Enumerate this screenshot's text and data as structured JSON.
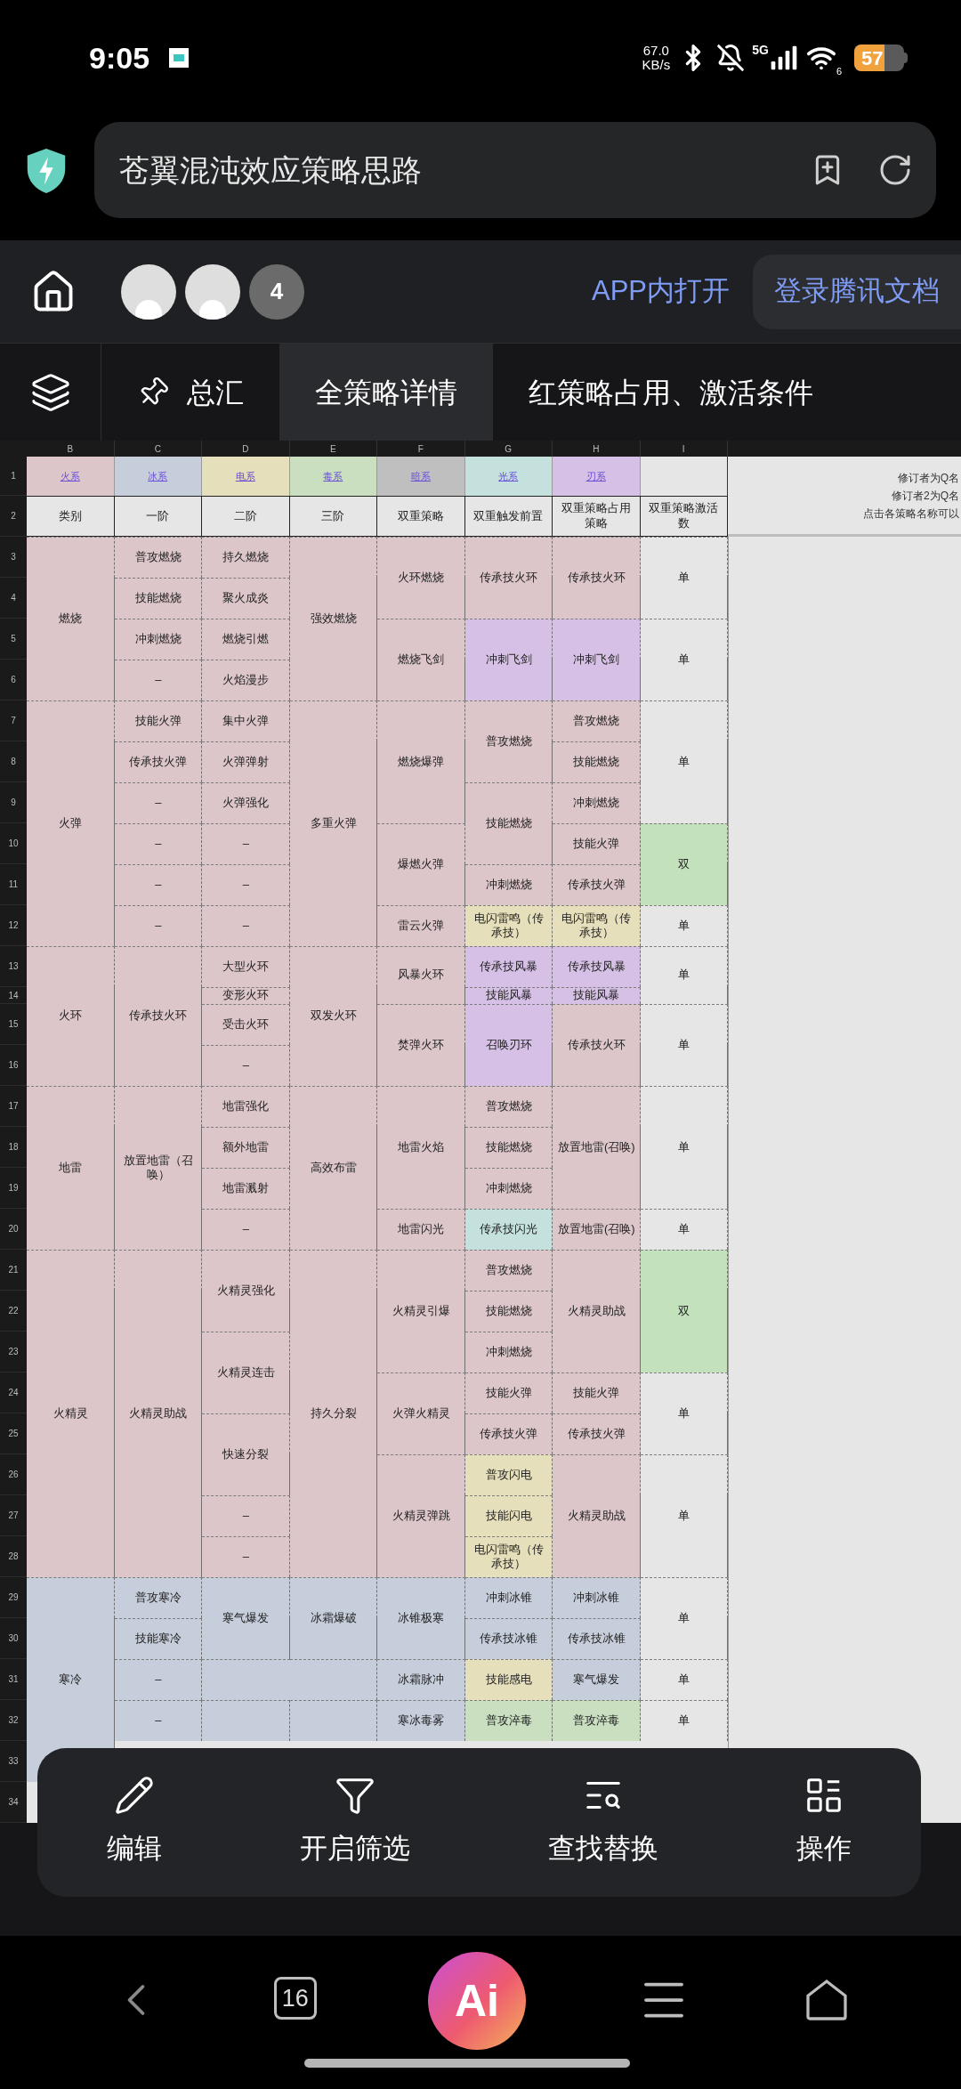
{
  "status_bar": {
    "time": "9:05",
    "net_speed": [
      "67.0",
      "KB/s"
    ],
    "network": "5G",
    "wifi_badge": "6",
    "battery": "57"
  },
  "address_bar": {
    "title": "苍翼混沌效应策略思路"
  },
  "app_header": {
    "collaborator_count": "4",
    "open_in_app": "APP内打开",
    "login": "登录腾讯文档"
  },
  "sheet_tabs": [
    {
      "label": "总汇",
      "selected": false,
      "pinned": true
    },
    {
      "label": "全策略详情",
      "selected": true,
      "pinned": false
    },
    {
      "label": "红策略占用、激活条件",
      "selected": false,
      "pinned": false
    }
  ],
  "sheet": {
    "column_letters": [
      "B",
      "C",
      "D",
      "E",
      "F",
      "G",
      "H",
      "I"
    ],
    "row_numbers": [
      "1",
      "2",
      "3",
      "4",
      "5",
      "6",
      "7",
      "8",
      "9",
      "10",
      "11",
      "12",
      "13",
      "14",
      "15",
      "16",
      "17",
      "18",
      "19",
      "20",
      "21",
      "22",
      "23",
      "24",
      "25",
      "26",
      "27",
      "28",
      "29",
      "30",
      "31",
      "32",
      "33",
      "34"
    ],
    "element_row": [
      {
        "label": "火系",
        "color": "#dcc6c9"
      },
      {
        "label": "冰系",
        "color": "#c6cedb"
      },
      {
        "label": "电系",
        "color": "#e6dfbb"
      },
      {
        "label": "毒系",
        "color": "#c9dfc0"
      },
      {
        "label": "暗系",
        "color": "#bfbfbf"
      },
      {
        "label": "光系",
        "color": "#c4e1dd"
      },
      {
        "label": "刃系",
        "color": "#d7c0e6"
      }
    ],
    "header_row": [
      "类别",
      "一阶",
      "二阶",
      "三阶",
      "双重策略",
      "双重触发前置",
      "双重策略占用策略",
      "双重策略激活数"
    ],
    "notes": [
      "修订者为Q名",
      "修订者2为Q名",
      "点击各策略名称可以"
    ],
    "columns": [
      [
        {
          "text": "燃烧",
          "color": "#dcc6c9",
          "merged_up": false
        },
        {
          "merged_up": true
        },
        {
          "merged_up": true
        },
        {
          "merged_up": true
        },
        {
          "text": "火弹",
          "color": "#dcc6c9",
          "merged_up": false
        },
        {
          "merged_up": true
        },
        {
          "merged_up": true
        },
        {
          "merged_up": true
        },
        {
          "merged_up": true
        },
        {
          "merged_up": true
        },
        {
          "text": "火环",
          "color": "#dcc6c9",
          "merged_up": false
        },
        {
          "merged_up": true
        },
        {
          "merged_up": true
        },
        {
          "merged_up": true
        },
        {
          "text": "地雷",
          "color": "#dcc6c9",
          "merged_up": false
        },
        {
          "merged_up": true
        },
        {
          "merged_up": true
        },
        {
          "merged_up": true
        },
        {
          "text": "火精灵",
          "color": "#dcc6c9",
          "merged_up": false
        },
        {
          "merged_up": true
        },
        {
          "merged_up": true
        },
        {
          "merged_up": true
        },
        {
          "merged_up": true
        },
        {
          "merged_up": true
        },
        {
          "merged_up": true
        },
        {
          "merged_up": true
        },
        {
          "text": "寒冷",
          "color": "#c6cedb",
          "merged_up": false
        },
        {
          "merged_up": true
        },
        {
          "merged_up": true
        },
        {
          "merged_up": true
        },
        {
          "merged_up": true
        }
      ],
      [
        {
          "text": "普攻燃烧",
          "color": "#dcc6c9",
          "merged_up": false
        },
        {
          "text": "技能燃烧",
          "color": "#dcc6c9",
          "merged_up": false
        },
        {
          "text": "冲刺燃烧",
          "color": "#dcc6c9",
          "merged_up": false
        },
        {
          "text": "–",
          "color": "#dcc6c9",
          "merged_up": false
        },
        {
          "text": "技能火弹",
          "color": "#dcc6c9",
          "merged_up": false
        },
        {
          "text": "传承技火弹",
          "color": "#dcc6c9",
          "merged_up": false
        },
        {
          "text": "–",
          "color": "#dcc6c9",
          "merged_up": false
        },
        {
          "text": "–",
          "color": "#dcc6c9",
          "merged_up": false
        },
        {
          "text": "–",
          "color": "#dcc6c9",
          "merged_up": false
        },
        {
          "text": "–",
          "color": "#dcc6c9",
          "merged_up": false
        },
        {
          "text": "传承技火环",
          "color": "#dcc6c9",
          "merged_up": false
        },
        {
          "merged_up": true
        },
        {
          "merged_up": true
        },
        {
          "merged_up": true
        },
        {
          "text": "放置地雷（召唤）",
          "color": "#dcc6c9",
          "merged_up": false
        },
        {
          "merged_up": true
        },
        {
          "merged_up": true
        },
        {
          "merged_up": true
        },
        {
          "text": "火精灵助战",
          "color": "#dcc6c9",
          "merged_up": false
        },
        {
          "merged_up": true
        },
        {
          "merged_up": true
        },
        {
          "merged_up": true
        },
        {
          "merged_up": true
        },
        {
          "merged_up": true
        },
        {
          "merged_up": true
        },
        {
          "merged_up": true
        },
        {
          "text": "普攻寒冷",
          "color": "#c6cedb",
          "merged_up": false
        },
        {
          "text": "技能寒冷",
          "color": "#c6cedb",
          "merged_up": false
        },
        {
          "text": "–",
          "color": "#c6cedb",
          "merged_up": false
        },
        {
          "text": "–",
          "color": "#c6cedb",
          "merged_up": false
        }
      ],
      [
        {
          "text": "持久燃烧",
          "color": "#dcc6c9",
          "merged_up": false
        },
        {
          "text": "聚火成炎",
          "color": "#dcc6c9",
          "merged_up": false
        },
        {
          "text": "燃烧引燃",
          "color": "#dcc6c9",
          "merged_up": false
        },
        {
          "text": "火焰漫步",
          "color": "#dcc6c9",
          "merged_up": false
        },
        {
          "text": "集中火弹",
          "color": "#dcc6c9",
          "merged_up": false
        },
        {
          "text": "火弹弹射",
          "color": "#dcc6c9",
          "merged_up": false
        },
        {
          "text": "火弹强化",
          "color": "#dcc6c9",
          "merged_up": false
        },
        {
          "text": "–",
          "color": "#dcc6c9",
          "merged_up": false
        },
        {
          "text": "–",
          "color": "#dcc6c9",
          "merged_up": false
        },
        {
          "text": "–",
          "color": "#dcc6c9",
          "merged_up": false
        },
        {
          "text": "大型火环",
          "color": "#dcc6c9",
          "merged_up": false
        },
        {
          "text": "变形火环",
          "color": "#dcc6c9",
          "merged_up": false
        },
        {
          "text": "受击火环",
          "color": "#dcc6c9",
          "merged_up": false
        },
        {
          "text": "–",
          "color": "#dcc6c9",
          "merged_up": false
        },
        {
          "text": "地雷强化",
          "color": "#dcc6c9",
          "merged_up": false
        },
        {
          "text": "额外地雷",
          "color": "#dcc6c9",
          "merged_up": false
        },
        {
          "text": "地雷溅射",
          "color": "#dcc6c9",
          "merged_up": false
        },
        {
          "text": "–",
          "color": "#dcc6c9",
          "merged_up": false
        },
        {
          "text": "火精灵强化",
          "color": "#dcc6c9",
          "merged_up": false
        },
        {
          "merged_up": true
        },
        {
          "text": "火精灵连击",
          "color": "#dcc6c9",
          "merged_up": false
        },
        {
          "merged_up": true
        },
        {
          "text": "快速分裂",
          "color": "#dcc6c9",
          "merged_up": false
        },
        {
          "merged_up": true
        },
        {
          "text": "–",
          "color": "#dcc6c9",
          "merged_up": false
        },
        {
          "text": "–",
          "color": "#dcc6c9",
          "merged_up": false
        },
        {
          "text": "寒气爆发",
          "color": "#c6cedb",
          "merged_up": false
        },
        {
          "merged_up": true
        },
        {
          "color": "#c6cedb",
          "merged_up": false,
          "merged_right": true
        },
        {
          "color": "#c6cedb",
          "merged_up": false
        }
      ],
      [
        {
          "text": "强效燃烧",
          "color": "#dcc6c9",
          "merged_up": false
        },
        {
          "merged_up": true
        },
        {
          "merged_up": true
        },
        {
          "merged_up": true
        },
        {
          "text": "多重火弹",
          "color": "#dcc6c9",
          "merged_up": false
        },
        {
          "merged_up": true
        },
        {
          "merged_up": true
        },
        {
          "merged_up": true
        },
        {
          "merged_up": true
        },
        {
          "merged_up": true
        },
        {
          "text": "双发火环",
          "color": "#dcc6c9",
          "merged_up": false
        },
        {
          "merged_up": true
        },
        {
          "merged_up": true
        },
        {
          "merged_up": true
        },
        {
          "text": "高效布雷",
          "color": "#dcc6c9",
          "merged_up": false
        },
        {
          "merged_up": true
        },
        {
          "merged_up": true
        },
        {
          "merged_up": true
        },
        {
          "text": "持久分裂",
          "color": "#dcc6c9",
          "merged_up": false
        },
        {
          "merged_up": true
        },
        {
          "merged_up": true
        },
        {
          "merged_up": true
        },
        {
          "merged_up": true
        },
        {
          "merged_up": true
        },
        {
          "merged_up": true
        },
        {
          "merged_up": true
        },
        {
          "text": "冰霜爆破",
          "color": "#c6cedb",
          "merged_up": false
        },
        {
          "merged_up": true
        },
        {
          "color": "#c6cedb",
          "merged_up": false
        },
        {
          "color": "#c6cedb",
          "merged_up": false
        }
      ],
      [
        {
          "text": "火环燃烧",
          "color": "#dcc6c9",
          "merged_up": false
        },
        {
          "merged_up": true
        },
        {
          "text": "燃烧飞剑",
          "color": "#dcc6c9",
          "merged_up": false
        },
        {
          "merged_up": true
        },
        {
          "text": "燃烧爆弹",
          "color": "#dcc6c9",
          "merged_up": false
        },
        {
          "merged_up": true
        },
        {
          "merged_up": true
        },
        {
          "text": "爆燃火弹",
          "color": "#dcc6c9",
          "merged_up": false
        },
        {
          "merged_up": true
        },
        {
          "text": "雷云火弹",
          "color": "#dcc6c9",
          "merged_up": false
        },
        {
          "text": "风暴火环",
          "color": "#dcc6c9",
          "merged_up": false
        },
        {
          "merged_up": true
        },
        {
          "text": "焚弹火环",
          "color": "#dcc6c9",
          "merged_up": false
        },
        {
          "merged_up": true
        },
        {
          "text": "地雷火焰",
          "color": "#dcc6c9",
          "merged_up": false
        },
        {
          "merged_up": true
        },
        {
          "merged_up": true
        },
        {
          "text": "地雷闪光",
          "color": "#dcc6c9",
          "merged_up": false
        },
        {
          "text": "火精灵引爆",
          "color": "#dcc6c9",
          "merged_up": false
        },
        {
          "merged_up": true
        },
        {
          "merged_up": true
        },
        {
          "text": "火弹火精灵",
          "color": "#dcc6c9",
          "merged_up": false
        },
        {
          "merged_up": true
        },
        {
          "text": "火精灵弹跳",
          "color": "#dcc6c9",
          "merged_up": false
        },
        {
          "merged_up": true
        },
        {
          "merged_up": true
        },
        {
          "text": "冰锥极寒",
          "color": "#c6cedb",
          "merged_up": false
        },
        {
          "merged_up": true
        },
        {
          "text": "冰霜脉冲",
          "color": "#c6cedb",
          "merged_up": false
        },
        {
          "text": "寒冰毒雾",
          "color": "#c6cedb",
          "merged_up": false
        }
      ],
      [
        {
          "text": "传承技火环",
          "color": "#dcc6c9",
          "merged_up": false
        },
        {
          "merged_up": true
        },
        {
          "text": "冲刺飞剑",
          "color": "#d7c0e6",
          "merged_up": false
        },
        {
          "merged_up": true
        },
        {
          "text": "普攻燃烧",
          "color": "#dcc6c9",
          "merged_up": false
        },
        {
          "merged_up": true
        },
        {
          "text": "技能燃烧",
          "color": "#dcc6c9",
          "merged_up": false
        },
        {
          "merged_up": true
        },
        {
          "text": "冲刺燃烧",
          "color": "#dcc6c9",
          "merged_up": false
        },
        {
          "text": "电闪雷鸣（传承技）",
          "color": "#e6dfbb",
          "merged_up": false
        },
        {
          "text": "传承技风暴",
          "color": "#d7c0e6",
          "merged_up": false
        },
        {
          "text": "技能风暴",
          "color": "#d7c0e6",
          "merged_up": false
        },
        {
          "text": "召唤刃环",
          "color": "#d7c0e6",
          "merged_up": false
        },
        {
          "merged_up": true
        },
        {
          "text": "普攻燃烧",
          "color": "#dcc6c9",
          "merged_up": false
        },
        {
          "text": "技能燃烧",
          "color": "#dcc6c9",
          "merged_up": false
        },
        {
          "text": "冲刺燃烧",
          "color": "#dcc6c9",
          "merged_up": false
        },
        {
          "text": "传承技闪光",
          "color": "#c4e1dd",
          "merged_up": false
        },
        {
          "text": "普攻燃烧",
          "color": "#dcc6c9",
          "merged_up": false
        },
        {
          "text": "技能燃烧",
          "color": "#dcc6c9",
          "merged_up": false
        },
        {
          "text": "冲刺燃烧",
          "color": "#dcc6c9",
          "merged_up": false
        },
        {
          "text": "技能火弹",
          "color": "#dcc6c9",
          "merged_up": false
        },
        {
          "text": "传承技火弹",
          "color": "#dcc6c9",
          "merged_up": false
        },
        {
          "text": "普攻闪电",
          "color": "#e6dfbb",
          "merged_up": false
        },
        {
          "text": "技能闪电",
          "color": "#e6dfbb",
          "merged_up": false
        },
        {
          "text": "电闪雷鸣（传承技）",
          "color": "#e6dfbb",
          "merged_up": false
        },
        {
          "text": "冲刺冰锥",
          "color": "#c6cedb",
          "merged_up": false
        },
        {
          "text": "传承技冰锥",
          "color": "#c6cedb",
          "merged_up": false
        },
        {
          "text": "技能感电",
          "color": "#e6dfbb",
          "merged_up": false
        },
        {
          "text": "普攻淬毒",
          "color": "#c9dfc0",
          "merged_up": false
        }
      ],
      [
        {
          "text": "传承技火环",
          "color": "#dcc6c9",
          "merged_up": false
        },
        {
          "merged_up": true
        },
        {
          "text": "冲刺飞剑",
          "color": "#d7c0e6",
          "merged_up": false
        },
        {
          "merged_up": true
        },
        {
          "text": "普攻燃烧",
          "color": "#dcc6c9",
          "merged_up": false
        },
        {
          "text": "技能燃烧",
          "color": "#dcc6c9",
          "merged_up": false
        },
        {
          "text": "冲刺燃烧",
          "color": "#dcc6c9",
          "merged_up": false
        },
        {
          "text": "技能火弹",
          "color": "#dcc6c9",
          "merged_up": false
        },
        {
          "text": "传承技火弹",
          "color": "#dcc6c9",
          "merged_up": false
        },
        {
          "text": "电闪雷鸣（传承技）",
          "color": "#e6dfbb",
          "merged_up": false
        },
        {
          "text": "传承技风暴",
          "color": "#d7c0e6",
          "merged_up": false
        },
        {
          "text": "技能风暴",
          "color": "#d7c0e6",
          "merged_up": false
        },
        {
          "text": "传承技火环",
          "color": "#dcc6c9",
          "merged_up": false
        },
        {
          "merged_up": true
        },
        {
          "text": "放置地雷(召唤)",
          "color": "#dcc6c9",
          "merged_up": false
        },
        {
          "merged_up": true
        },
        {
          "merged_up": true
        },
        {
          "text": "放置地雷(召唤)",
          "color": "#dcc6c9",
          "merged_up": false
        },
        {
          "text": "火精灵助战",
          "color": "#dcc6c9",
          "merged_up": false
        },
        {
          "merged_up": true
        },
        {
          "merged_up": true
        },
        {
          "text": "技能火弹",
          "color": "#dcc6c9",
          "merged_up": false
        },
        {
          "text": "传承技火弹",
          "color": "#dcc6c9",
          "merged_up": false
        },
        {
          "text": "火精灵助战",
          "color": "#dcc6c9",
          "merged_up": false
        },
        {
          "merged_up": true
        },
        {
          "merged_up": true
        },
        {
          "text": "冲刺冰锥",
          "color": "#c6cedb",
          "merged_up": false
        },
        {
          "text": "传承技冰锥",
          "color": "#c6cedb",
          "merged_up": false
        },
        {
          "text": "寒气爆发",
          "color": "#c6cedb",
          "merged_up": false
        },
        {
          "text": "普攻淬毒",
          "color": "#c9dfc0",
          "merged_up": false
        }
      ],
      [
        {
          "text": "单",
          "color": "#e6e6e6",
          "merged_up": false
        },
        {
          "merged_up": true
        },
        {
          "text": "单",
          "color": "#e6e6e6",
          "merged_up": false
        },
        {
          "merged_up": true
        },
        {
          "text": "单",
          "color": "#e6e6e6",
          "merged_up": false
        },
        {
          "merged_up": true
        },
        {
          "merged_up": true
        },
        {
          "text": "双",
          "color": "#c3e2bc",
          "merged_up": false
        },
        {
          "merged_up": true
        },
        {
          "text": "单",
          "color": "#e6e6e6",
          "merged_up": false
        },
        {
          "text": "单",
          "color": "#e6e6e6",
          "merged_up": false
        },
        {
          "merged_up": true
        },
        {
          "text": "单",
          "color": "#e6e6e6",
          "merged_up": false
        },
        {
          "merged_up": true
        },
        {
          "text": "单",
          "color": "#e6e6e6",
          "merged_up": false
        },
        {
          "merged_up": true
        },
        {
          "merged_up": true
        },
        {
          "text": "单",
          "color": "#e6e6e6",
          "merged_up": false
        },
        {
          "text": "双",
          "color": "#c3e2bc",
          "merged_up": false
        },
        {
          "merged_up": true
        },
        {
          "merged_up": true
        },
        {
          "text": "单",
          "color": "#e6e6e6",
          "merged_up": false
        },
        {
          "merged_up": true
        },
        {
          "text": "单",
          "color": "#e6e6e6",
          "merged_up": false
        },
        {
          "merged_up": true
        },
        {
          "merged_up": true
        },
        {
          "text": "单",
          "color": "#e6e6e6",
          "merged_up": false
        },
        {
          "merged_up": true
        },
        {
          "text": "单",
          "color": "#e6e6e6",
          "merged_up": false
        },
        {
          "text": "单",
          "color": "#e6e6e6",
          "merged_up": false
        }
      ]
    ]
  },
  "toolbar": [
    {
      "label": "编辑",
      "kind": "edit"
    },
    {
      "label": "开启筛选",
      "kind": "filter"
    },
    {
      "label": "查找替换",
      "kind": "find"
    },
    {
      "label": "操作",
      "kind": "actions"
    }
  ],
  "nav_bar": {
    "tab_count": "16",
    "assistant": "Ai"
  }
}
